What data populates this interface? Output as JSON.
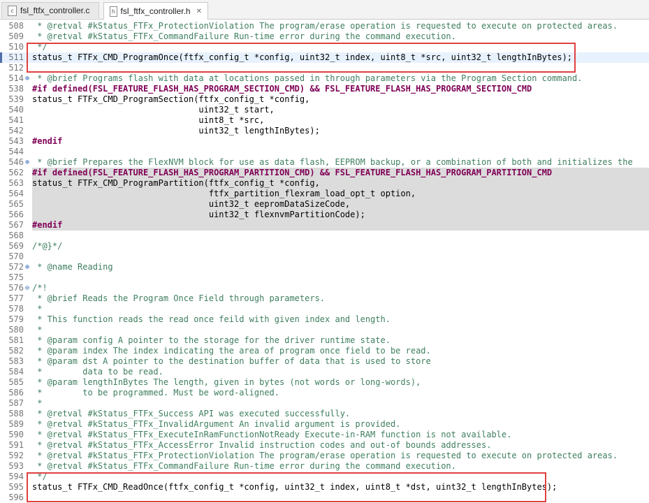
{
  "tabs": [
    {
      "label": "fsl_ftfx_controller.c",
      "icon": "c-file-icon"
    },
    {
      "label": "fsl_ftfx_controller.h",
      "icon": "h-file-icon",
      "active": true
    }
  ],
  "lines": [
    {
      "n": "508",
      "fold": "",
      "type": "cmt",
      "text": " * @retval #kStatus_FTFx_ProtectionViolation The program/erase operation is requested to execute on protected areas."
    },
    {
      "n": "509",
      "fold": "",
      "type": "cmt",
      "text": " * @retval #kStatus_FTFx_CommandFailure Run-time error during the command execution."
    },
    {
      "n": "510",
      "fold": "",
      "type": "cmt",
      "text": " */"
    },
    {
      "n": "511",
      "fold": "",
      "type": "code",
      "text": "status_t FTFx_CMD_ProgramOnce(ftfx_config_t *config, uint32_t index, uint8_t *src, uint32_t lengthInBytes);"
    },
    {
      "n": "512",
      "fold": "",
      "type": "code",
      "text": ""
    },
    {
      "n": "514",
      "fold": "+",
      "type": "cmt",
      "text": " * @brief Programs flash with data at locations passed in through parameters via the Program Section command."
    },
    {
      "n": "538",
      "fold": "",
      "type": "pp",
      "text": "#if defined(FSL_FEATURE_FLASH_HAS_PROGRAM_SECTION_CMD) && FSL_FEATURE_FLASH_HAS_PROGRAM_SECTION_CMD"
    },
    {
      "n": "539",
      "fold": "",
      "type": "code",
      "text": "status_t FTFx_CMD_ProgramSection(ftfx_config_t *config,"
    },
    {
      "n": "540",
      "fold": "",
      "type": "code",
      "text": "                                 uint32_t start,"
    },
    {
      "n": "541",
      "fold": "",
      "type": "code",
      "text": "                                 uint8_t *src,"
    },
    {
      "n": "542",
      "fold": "",
      "type": "code",
      "text": "                                 uint32_t lengthInBytes);"
    },
    {
      "n": "543",
      "fold": "",
      "type": "pp",
      "text": "#endif"
    },
    {
      "n": "544",
      "fold": "",
      "type": "code",
      "text": ""
    },
    {
      "n": "546",
      "fold": "+",
      "type": "cmt",
      "text": " * @brief Prepares the FlexNVM block for use as data flash, EEPROM backup, or a combination of both and initializes the"
    },
    {
      "n": "562",
      "fold": "",
      "type": "pp",
      "shaded": true,
      "text": "#if defined(FSL_FEATURE_FLASH_HAS_PROGRAM_PARTITION_CMD) && FSL_FEATURE_FLASH_HAS_PROGRAM_PARTITION_CMD"
    },
    {
      "n": "563",
      "fold": "",
      "type": "code",
      "shaded": true,
      "text": "status_t FTFx_CMD_ProgramPartition(ftfx_config_t *config,"
    },
    {
      "n": "564",
      "fold": "",
      "type": "code",
      "shaded": true,
      "text": "                                   ftfx_partition_flexram_load_opt_t option,"
    },
    {
      "n": "565",
      "fold": "",
      "type": "code",
      "shaded": true,
      "text": "                                   uint32_t eepromDataSizeCode,"
    },
    {
      "n": "566",
      "fold": "",
      "type": "code",
      "shaded": true,
      "text": "                                   uint32_t flexnvmPartitionCode);"
    },
    {
      "n": "567",
      "fold": "",
      "type": "pp",
      "shaded": true,
      "text": "#endif"
    },
    {
      "n": "568",
      "fold": "",
      "type": "code",
      "text": ""
    },
    {
      "n": "569",
      "fold": "",
      "type": "cmt",
      "text": "/*@}*/"
    },
    {
      "n": "570",
      "fold": "",
      "type": "code",
      "text": ""
    },
    {
      "n": "572",
      "fold": "+",
      "type": "cmt",
      "text": " * @name Reading"
    },
    {
      "n": "575",
      "fold": "",
      "type": "code",
      "text": ""
    },
    {
      "n": "576",
      "fold": "-",
      "type": "cmt",
      "text": "/*!"
    },
    {
      "n": "577",
      "fold": "",
      "type": "cmt",
      "text": " * @brief Reads the Program Once Field through parameters."
    },
    {
      "n": "578",
      "fold": "",
      "type": "cmt",
      "text": " *"
    },
    {
      "n": "579",
      "fold": "",
      "type": "cmt",
      "text": " * This function reads the read once feild with given index and length."
    },
    {
      "n": "580",
      "fold": "",
      "type": "cmt",
      "text": " *"
    },
    {
      "n": "581",
      "fold": "",
      "type": "cmt",
      "text": " * @param config A pointer to the storage for the driver runtime state."
    },
    {
      "n": "582",
      "fold": "",
      "type": "cmt",
      "text": " * @param index The index indicating the area of program once field to be read."
    },
    {
      "n": "583",
      "fold": "",
      "type": "cmt",
      "text": " * @param dst A pointer to the destination buffer of data that is used to store"
    },
    {
      "n": "584",
      "fold": "",
      "type": "cmt",
      "text": " *        data to be read."
    },
    {
      "n": "585",
      "fold": "",
      "type": "cmt",
      "text": " * @param lengthInBytes The length, given in bytes (not words or long-words),"
    },
    {
      "n": "586",
      "fold": "",
      "type": "cmt",
      "text": " *        to be programmed. Must be word-aligned."
    },
    {
      "n": "587",
      "fold": "",
      "type": "cmt",
      "text": " *"
    },
    {
      "n": "588",
      "fold": "",
      "type": "cmt",
      "text": " * @retval #kStatus_FTFx_Success API was executed successfully."
    },
    {
      "n": "589",
      "fold": "",
      "type": "cmt",
      "text": " * @retval #kStatus_FTFx_InvalidArgument An invalid argument is provided."
    },
    {
      "n": "590",
      "fold": "",
      "type": "cmt",
      "text": " * @retval #kStatus_FTFx_ExecuteInRamFunctionNotReady Execute-in-RAM function is not available."
    },
    {
      "n": "591",
      "fold": "",
      "type": "cmt",
      "text": " * @retval #kStatus_FTFx_AccessError Invalid instruction codes and out-of bounds addresses."
    },
    {
      "n": "592",
      "fold": "",
      "type": "cmt",
      "text": " * @retval #kStatus_FTFx_ProtectionViolation The program/erase operation is requested to execute on protected areas."
    },
    {
      "n": "593",
      "fold": "",
      "type": "cmt",
      "text": " * @retval #kStatus_FTFx_CommandFailure Run-time error during the command execution."
    },
    {
      "n": "594",
      "fold": "",
      "type": "cmt",
      "text": " */"
    },
    {
      "n": "595",
      "fold": "",
      "type": "code",
      "text": "status_t FTFx_CMD_ReadOnce(ftfx_config_t *config, uint32_t index, uint8_t *dst, uint32_t lengthInBytes);"
    },
    {
      "n": "596",
      "fold": "",
      "type": "code",
      "text": ""
    }
  ],
  "colors": {
    "comment": "#3f7f5f",
    "preprocessor": "#7f0055",
    "highlight_box": "#e04040",
    "shaded": "#dcdcdc"
  }
}
